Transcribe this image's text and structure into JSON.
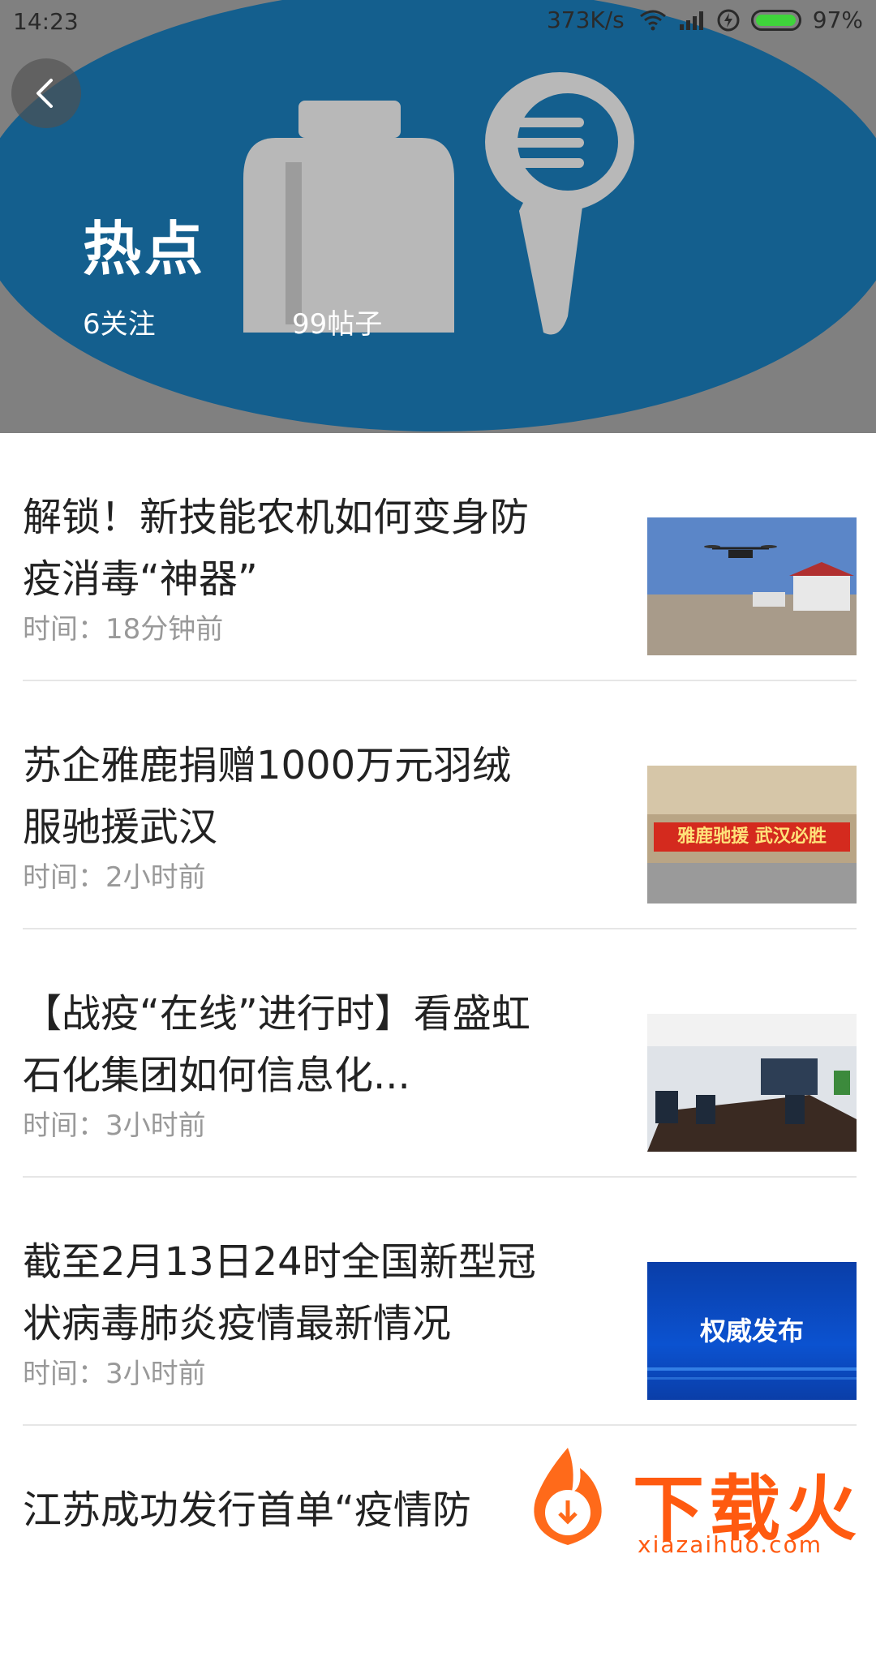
{
  "status_bar": {
    "time": "14:23",
    "speed": "373K/s",
    "battery_percent": "97%",
    "battery_level": 0.97,
    "icons": [
      "wifi-icon",
      "signal-icon",
      "charging-icon",
      "battery-icon"
    ]
  },
  "header": {
    "title": "热点",
    "followers": "6关注",
    "posts": "99帖子",
    "back_icon": "chevron-left-icon",
    "colors": {
      "oval": "#1a7ab6",
      "overlay": "#808080"
    }
  },
  "articles": [
    {
      "title": "解锁！新技能农机如何变身防疫消毒“神器”",
      "time": "时间：18分钟前",
      "thumb": "drone-over-field"
    },
    {
      "title": "苏企雅鹿捐赠1000万元羽绒服驰援武汉",
      "time": "时间：2小时前",
      "thumb": "donation-banner",
      "thumb_text": "雅鹿驰援 武汉必胜"
    },
    {
      "title": "【战疫“在线”进行时】看盛虹石化集团如何信息化...",
      "time": "时间：3小时前",
      "thumb": "video-conference-room"
    },
    {
      "title": "截至2月13日24时全国新型冠状病毒肺炎疫情最新情况",
      "time": "时间：3小时前",
      "thumb": "official-release",
      "thumb_text": "权威发布"
    },
    {
      "title": "江苏成功发行首单“疫情防",
      "time": "",
      "thumb": ""
    }
  ],
  "watermark": {
    "brand": "下载火",
    "url": "xiazaihuo.com"
  }
}
